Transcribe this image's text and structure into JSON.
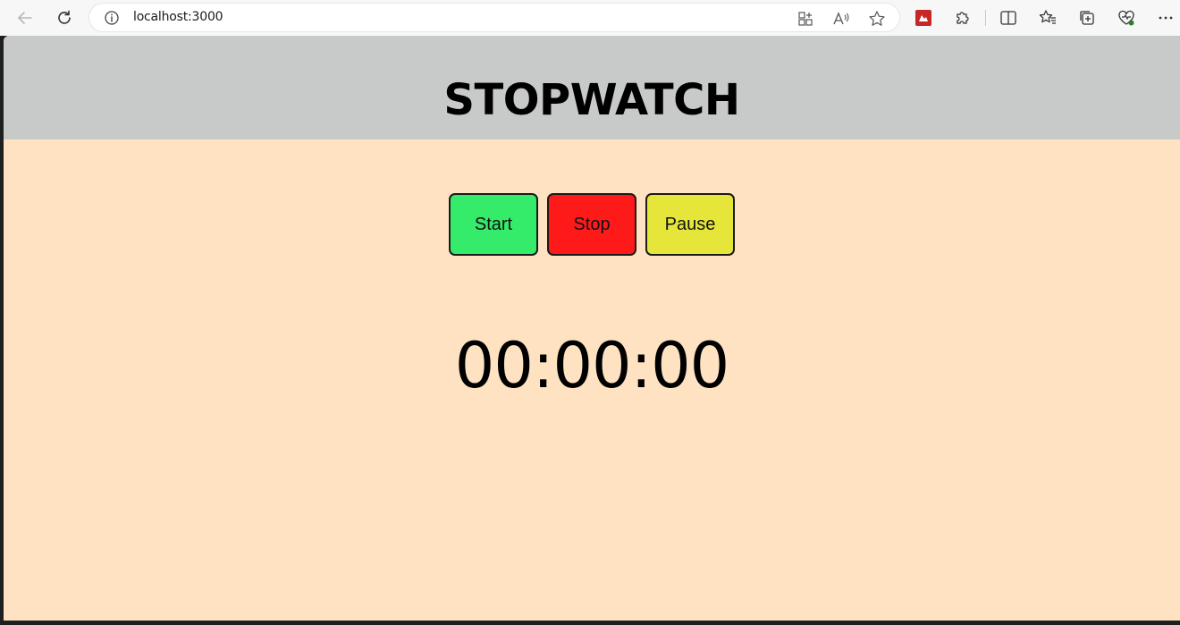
{
  "browser": {
    "url": "localhost:3000",
    "icons": [
      "back-arrow-icon",
      "reload-icon",
      "info-icon",
      "app-available-icon",
      "read-aloud-icon",
      "favorite-star-icon",
      "extension-tile-icon",
      "extensions-puzzle-icon",
      "split-screen-icon",
      "favorites-icon",
      "collections-icon",
      "browser-essentials-icon",
      "more-menu-icon"
    ]
  },
  "page": {
    "title": "STOPWATCH",
    "header_bg": "#c8cac9",
    "body_bg": "#ffe2c2"
  },
  "buttons": [
    {
      "label": "Start",
      "color": "#35ec6a"
    },
    {
      "label": "Stop",
      "color": "#ff1a1a"
    },
    {
      "label": "Pause",
      "color": "#e6e63a"
    }
  ],
  "timer": {
    "display": "00:00:00"
  }
}
